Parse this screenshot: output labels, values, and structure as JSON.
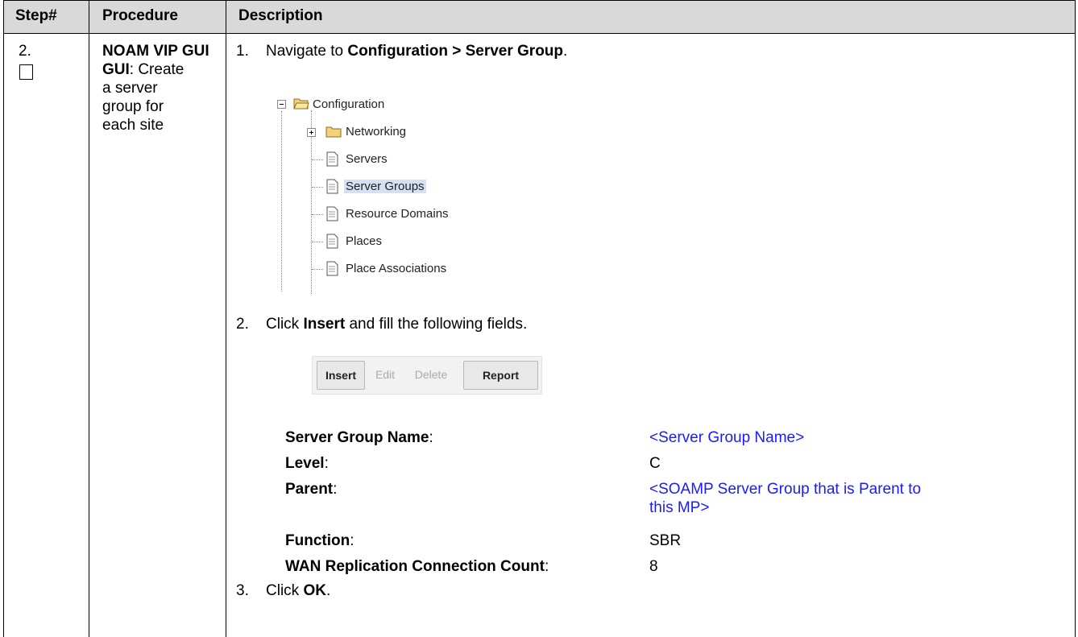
{
  "table": {
    "headers": {
      "step": "Step#",
      "procedure": "Procedure",
      "description": "Description"
    }
  },
  "row": {
    "step_number": "2.",
    "procedure_title": "NOAM VIP GUI",
    "procedure_lines": [
      ": Create",
      "a server",
      "group for",
      "each site"
    ],
    "step1": {
      "num": "1.",
      "prefix": "Navigate to ",
      "path": "Configuration > Server Group",
      "suffix": "."
    },
    "tree": {
      "root": "Configuration",
      "networking": "Networking",
      "items": [
        "Servers",
        "Server Groups",
        "Resource Domains",
        "Places",
        "Place Associations"
      ],
      "selected": "Server Groups",
      "icons": {
        "root": "open-folder-icon",
        "networking": "folder-icon",
        "item": "document-icon"
      }
    },
    "step2": {
      "num": "2.",
      "prefix": "Click ",
      "action": "Insert",
      "suffix": " and fill the following fields."
    },
    "buttons": [
      {
        "label": "Insert",
        "enabled": true
      },
      {
        "label": "Edit",
        "enabled": false
      },
      {
        "label": "Delete",
        "enabled": false
      },
      {
        "label": "Report",
        "enabled": true
      }
    ],
    "fields": [
      {
        "label": "Server Group Name",
        "value": "<Server Group Name>",
        "value_line2": "",
        "placeholder": true
      },
      {
        "label": "Level",
        "value": "C",
        "value_line2": "",
        "placeholder": false
      },
      {
        "label": "Parent",
        "value": "<SOAMP Server Group that is Parent to",
        "value_line2": "this MP>",
        "placeholder": true
      },
      {
        "label": "Function",
        "value": "SBR",
        "value_line2": "",
        "placeholder": false
      },
      {
        "label": "WAN Replication Connection Count",
        "value": "8",
        "value_line2": "",
        "placeholder": false
      }
    ],
    "step3": {
      "num": "3.",
      "prefix": "Click ",
      "action": "OK",
      "suffix": "."
    }
  },
  "colors": {
    "header_bg": "#d9d9d9",
    "placeholder_text": "#1a1aff",
    "selected_item_bg": "#d6e0f5"
  }
}
